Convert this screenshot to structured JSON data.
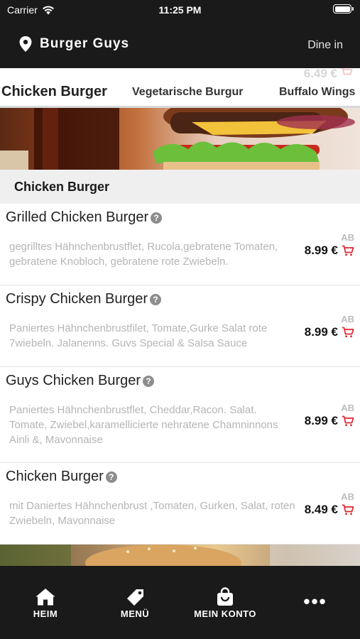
{
  "status_bar": {
    "carrier": "Carrier",
    "time": "11:25 PM"
  },
  "header": {
    "title": "Burger Guys",
    "mode": "Dine in",
    "icon": "location-pin-icon"
  },
  "ghost_row": {
    "price": "6.49 €"
  },
  "tabs": [
    {
      "label": "Chicken Burger",
      "active": true
    },
    {
      "label": "Vegetarische Burgur",
      "active": false
    },
    {
      "label": "Buffalo Wings",
      "active": false
    }
  ],
  "section": {
    "title": "Chicken Burger"
  },
  "items": [
    {
      "name": "Grilled Chicken Burger",
      "description": "gegrilltes Hähnchenbrustflet, Rucola,gebratene Tomaten, gebratene Knobloch, gebratene rote Zwiebeln.",
      "prefix": "AB",
      "price": "8.99 €"
    },
    {
      "name": "Crispy Chicken Burger",
      "description": "Paniertes Hähnchenbrustfilet, Tomate,Gurke Salat rote 7wiebeln. Jalanenns. Guvs Special & Salsa Sauce",
      "prefix": "AB",
      "price": "8.99 €"
    },
    {
      "name": "Guys Chicken Burger",
      "description": "Paniertes Hähnchenbrustflet, Cheddar,Racon. Salat. Tomate, Zwiebel,karamellicierte nehratene Chamninnons Ainli &, Mavonnaise",
      "prefix": "AB",
      "price": "8.99 €"
    },
    {
      "name": "Chicken Burger",
      "description": "mit Daniertes Hähnchenbrust ,Tomaten, Gurken, Salat, roten Zwiebeln, Mavonnaise",
      "prefix": "AB",
      "price": "8.49 €"
    }
  ],
  "tab_bar": [
    {
      "label": "HEIM",
      "icon": "home-icon"
    },
    {
      "label": "MENÜ",
      "icon": "tag-icon"
    },
    {
      "label": "MEIN KONTO",
      "icon": "shopping-bag-icon"
    },
    {
      "label": "",
      "icon": "more-icon"
    }
  ],
  "colors": {
    "bar_background": "#1a1a1a",
    "cart_red": "#e0242d",
    "section_bg": "#efefef"
  }
}
